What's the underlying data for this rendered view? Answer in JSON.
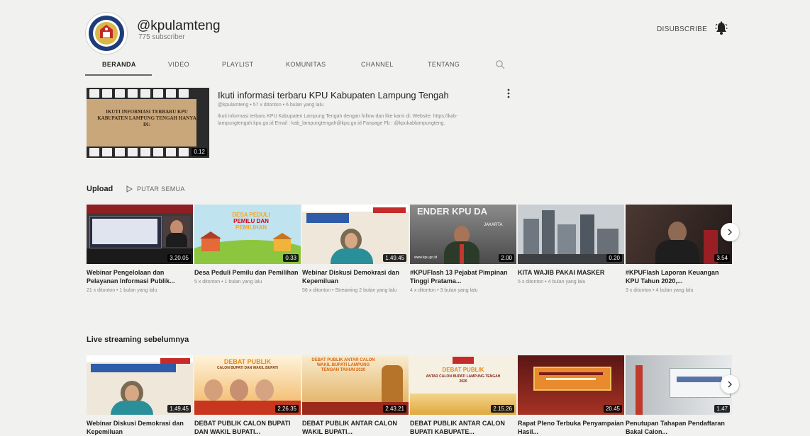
{
  "channel": {
    "name": "@kpulamteng",
    "subscribers": "775 subscriber",
    "subscribe_label": "DISUBSCRIBE"
  },
  "tabs": [
    {
      "label": "BERANDA"
    },
    {
      "label": "VIDEO"
    },
    {
      "label": "PLAYLIST"
    },
    {
      "label": "KOMUNITAS"
    },
    {
      "label": "CHANNEL"
    },
    {
      "label": "TENTANG"
    }
  ],
  "featured": {
    "thumb_text": "IKUTI INFORMASI TERBARU KPU KABUPATEN LAMPUNG TENGAH HANYA DI:",
    "duration": "0.12",
    "title": "Ikuti informasi terbaru KPU Kabupaten Lampung Tengah",
    "meta": "@kpulamteng • 57 x ditonton • 6 bulan yang lalu",
    "description": "Ikuti informasi terbaru KPU Kabupaten Lampung Tengah dengan follow dan like kami di: Website: https://kab-lampungtengah.kpu.go.id Email : kab_lampungtengah@kpu.go.id Fanpage Fb : @kpukablampungteng."
  },
  "uploads": {
    "title": "Upload",
    "play_all": "PUTAR SEMUA",
    "videos": [
      {
        "title": "Webinar Pengelolaan dan Pelayanan Informasi Publik...",
        "meta": "21 x ditonton • 1 bulan yang lalu",
        "duration": "3.20.05"
      },
      {
        "title": "Desa Peduli Pemilu dan Pemilihan",
        "meta": "5 x ditonton • 1 bulan yang lalu",
        "duration": "0.33"
      },
      {
        "title": "Webinar Diskusi Demokrasi dan Kepemiluan",
        "meta": "56 x ditonton • Streaming 2 bulan yang lalu",
        "duration": "1.49.45"
      },
      {
        "title": "#KPUFlash 13 Pejabat Pimpinan Tinggi Pratama...",
        "meta": "4 x ditonton • 3 bulan yang lalu",
        "duration": "2.00"
      },
      {
        "title": "KITA WAJIB PAKAI MASKER",
        "meta": "5 x ditonton • 4 bulan yang lalu",
        "duration": "0.20"
      },
      {
        "title": "#KPUFlash Laporan Keuangan KPU Tahun 2020,...",
        "meta": "3 x ditonton • 4 bulan yang lalu",
        "duration": "3.54"
      }
    ]
  },
  "live": {
    "title": "Live streaming sebelumnya",
    "videos": [
      {
        "title": "Webinar Diskusi Demokrasi dan Kepemiluan",
        "duration": "1.49.45"
      },
      {
        "title": "DEBAT PUBLIK CALON BUPATI DAN WAKIL BUPATI...",
        "duration": "2.26.35"
      },
      {
        "title": "DEBAT PUBLIK ANTAR CALON WAKIL BUPATI...",
        "duration": "2.43.21"
      },
      {
        "title": "DEBAT PUBLIK ANTAR CALON BUPATI KABUPATE...",
        "duration": "2.15.26"
      },
      {
        "title": "Rapat Pleno Terbuka Penyampaian Hasil...",
        "duration": "20.45"
      },
      {
        "title": "Penutupan Tahapan Pendaftaran Bakal Calon...",
        "duration": "1.47"
      }
    ]
  },
  "thumb_text": {
    "u1_banner": "",
    "u2_line1": "DESA PEDULI",
    "u2_line2": "PEMILU DAN",
    "u2_line3": "PEMILIHAN",
    "u4_text": "ENDER  KPU DA",
    "u4_city": "JAKARTA",
    "u4_url": "www.kpu.go.id",
    "l2_head": "DEBAT PUBLIK",
    "l2_sub": "CALON BUPATI DAN WAKIL BUPATI",
    "l3_head": "DEBAT PUBLIK ANTAR CALON WAKIL BUPATI LAMPUNG TENGAH TAHUN 2020",
    "l4_head": "DEBAT PUBLIK",
    "l4_sub": "ANTAR CALON BUPATI LAMPUNG TENGAH 2020"
  },
  "colors": {
    "background": "#f1f1ef",
    "duration_badge": "#000000",
    "kpu_red": "#b8262b",
    "debat_orange": "#e58a1e"
  }
}
